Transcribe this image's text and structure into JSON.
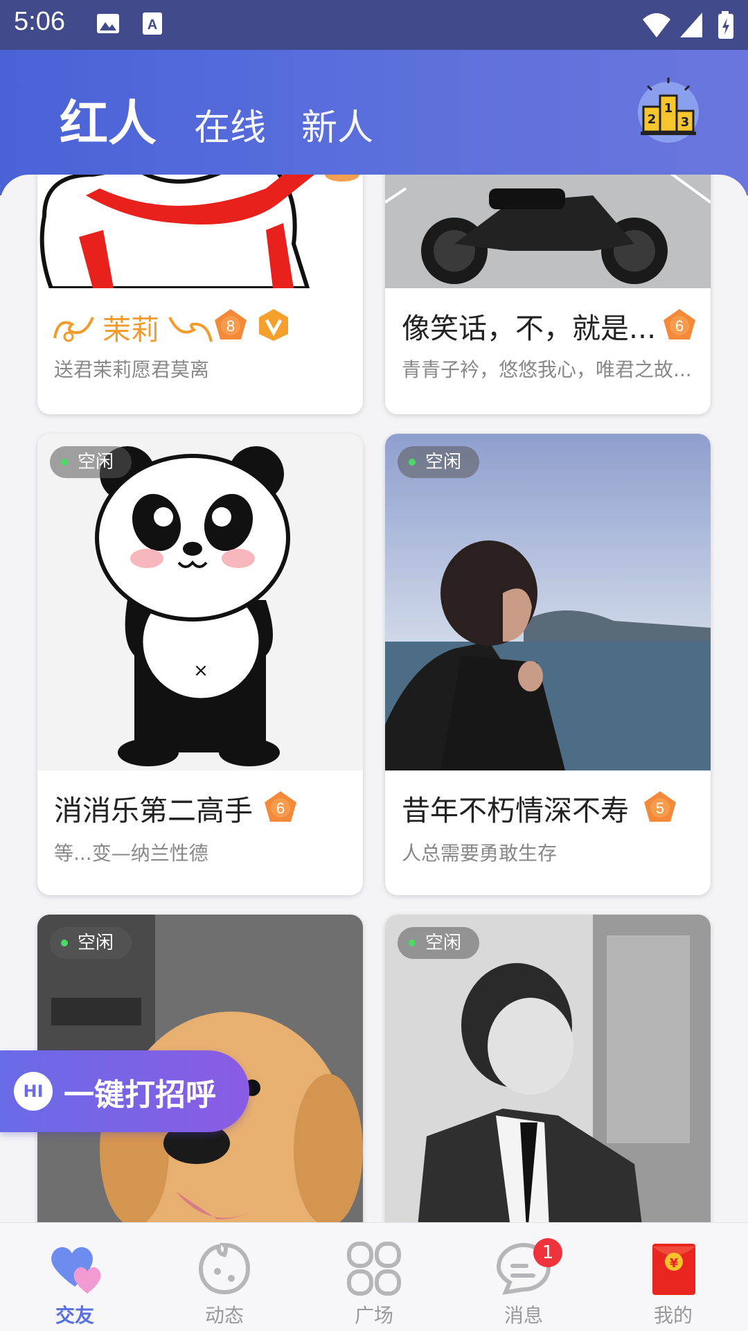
{
  "status_bar": {
    "time": "5:06"
  },
  "header": {
    "tabs": [
      {
        "label": "红人",
        "active": true
      },
      {
        "label": "在线",
        "active": false
      },
      {
        "label": "新人",
        "active": false
      }
    ]
  },
  "cards": [
    {
      "name": "茉莉",
      "signature": "送君茉莉愿君莫离",
      "level": "8",
      "verified": true,
      "status": ""
    },
    {
      "name": "像笑话，不，就是...",
      "signature": "青青子衿，悠悠我心，唯君之故...",
      "level": "6",
      "status": ""
    },
    {
      "name": "消消乐第二高手",
      "signature": "等...变—纳兰性德",
      "level": "6",
      "status": "空闲"
    },
    {
      "name": "昔年不朽情深不寿",
      "signature": "人总需要勇敢生存",
      "level": "5",
      "status": "空闲"
    },
    {
      "name": "",
      "signature": "",
      "level": "",
      "status": "空闲"
    },
    {
      "name": "",
      "signature": "",
      "level": "",
      "status": "空闲"
    }
  ],
  "greet_button": {
    "icon_text": "HI",
    "label": "一键打招呼"
  },
  "bottom_nav": [
    {
      "label": "交友",
      "active": true
    },
    {
      "label": "动态",
      "active": false
    },
    {
      "label": "广场",
      "active": false
    },
    {
      "label": "消息",
      "active": false,
      "badge": "1"
    },
    {
      "label": "我的",
      "active": false
    }
  ],
  "colors": {
    "accent": "#5a6fe0",
    "header_start": "#4a62d6",
    "badge_orange": "#f5893a",
    "online_dot": "#4cd964"
  }
}
